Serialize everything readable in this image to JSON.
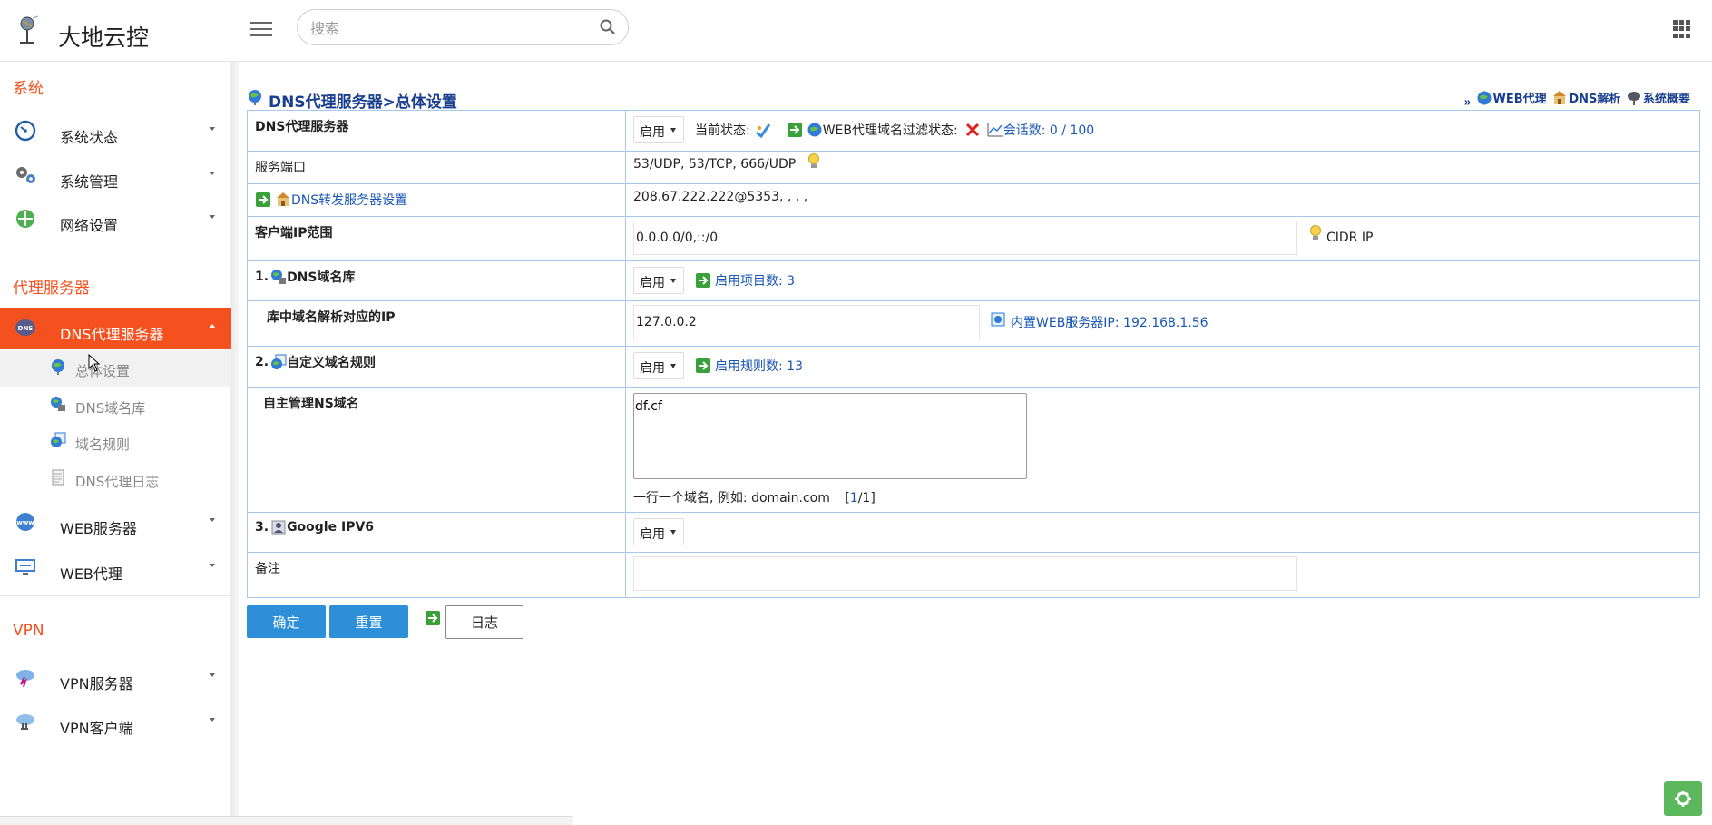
{
  "app": {
    "title": "大地云控"
  },
  "search": {
    "placeholder": "搜索"
  },
  "sidebar": {
    "sections": [
      {
        "title": "系统"
      },
      {
        "title": "代理服务器"
      },
      {
        "title": "VPN"
      }
    ],
    "items": [
      {
        "label": "系统状态",
        "icon": "dashboard-icon"
      },
      {
        "label": "系统管理",
        "icon": "gears-icon"
      },
      {
        "label": "网络设置",
        "icon": "network-icon"
      },
      {
        "label": "DNS代理服务器",
        "icon": "dns-icon"
      },
      {
        "label": "WEB服务器",
        "icon": "www-icon"
      },
      {
        "label": "WEB代理",
        "icon": "monitor-icon"
      },
      {
        "label": "VPN服务器",
        "icon": "cloud-bolt-icon"
      },
      {
        "label": "VPN客户端",
        "icon": "cloud-plug-icon"
      }
    ],
    "subitems": [
      {
        "label": "总体设置",
        "icon": "globe-icon"
      },
      {
        "label": "DNS域名库",
        "icon": "globe-server-icon"
      },
      {
        "label": "域名规则",
        "icon": "rules-icon"
      },
      {
        "label": "DNS代理日志",
        "icon": "log-icon"
      }
    ]
  },
  "page": {
    "title": "DNS代理服务器>总体设置",
    "quick_links_prefix": "»",
    "quick_links": [
      "WEB代理",
      "DNS解析",
      "系统概要"
    ]
  },
  "form": {
    "row1": {
      "label": "DNS代理服务器",
      "select": "启用",
      "status_label": "当前状态:",
      "web_filter_label": "WEB代理域名过滤状态:",
      "sessions_label": "会话数: 0 / 100"
    },
    "row2": {
      "label": "服务端口",
      "value": "53/UDP, 53/TCP, 666/UDP"
    },
    "row3": {
      "label": "DNS转发服务器设置",
      "value": "208.67.222.222@5353, , , ,"
    },
    "row4": {
      "label": "客户端IP范围",
      "value": "0.0.0.0/0,::/0",
      "hint": "CIDR IP"
    },
    "row5": {
      "num": "1.",
      "label": "DNS域名库",
      "select": "启用",
      "link": "启用项目数: 3"
    },
    "row6": {
      "label": "库中域名解析对应的IP",
      "value": "127.0.0.2",
      "link": "内置WEB服务器IP: 192.168.1.56"
    },
    "row7": {
      "num": "2.",
      "label": "自定义域名规则",
      "select": "启用",
      "link": "启用规则数: 13"
    },
    "row8": {
      "label": "自主管理NS域名",
      "value": "df.cf",
      "hint": "一行一个域名, 例如: domain.com",
      "page_open": "[",
      "page_cur": "1",
      "page_sep": "/",
      "page_total": "1",
      "page_close": "]"
    },
    "row9": {
      "num": "3.",
      "label": "Google IPV6",
      "select": "启用"
    },
    "row10": {
      "label": "备注",
      "value": ""
    }
  },
  "buttons": {
    "confirm": "确定",
    "reset": "重置",
    "log": "日志"
  },
  "colors": {
    "accent": "#f4511e",
    "primary": "#2d8fd7",
    "link": "#1a57b5",
    "title": "#1a3f8f",
    "fab": "#5cb85c"
  }
}
